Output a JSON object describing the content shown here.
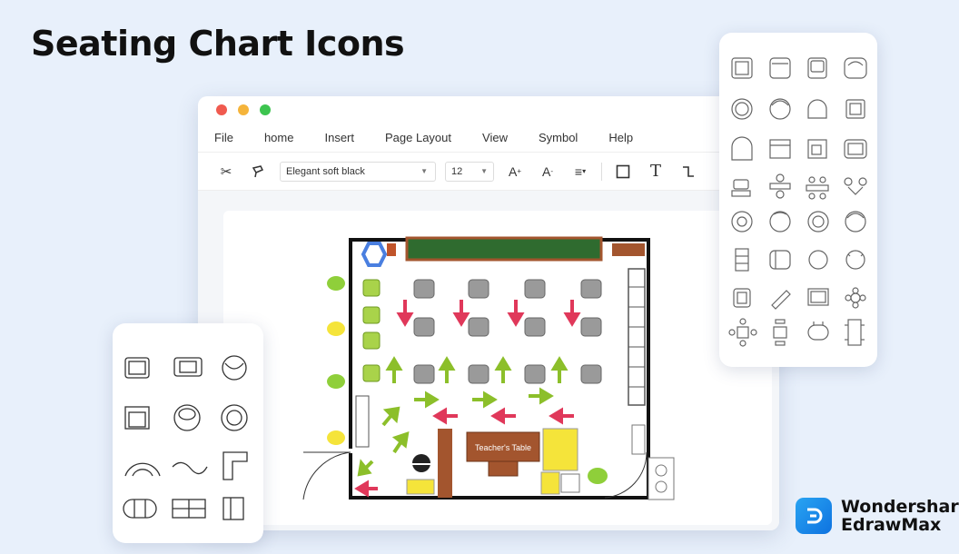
{
  "hero": {
    "title": "Seating Chart Icons"
  },
  "window": {
    "menu": [
      "File",
      "home",
      "Insert",
      "Page Layout",
      "View",
      "Symbol",
      "Help"
    ],
    "toolbar": {
      "font_name": "Elegant soft black",
      "font_size": "12",
      "icons": [
        "cut-icon",
        "format-painter-icon",
        "font-increase-icon",
        "font-decrease-icon",
        "align-icon",
        "rectangle-icon",
        "text-icon",
        "connector-icon"
      ]
    }
  },
  "floorplan": {
    "teacher_table_label": "Teacher's Table"
  },
  "brand": {
    "line1": "Wondershare",
    "line2": "EdrawMax"
  },
  "colors": {
    "background": "#e8f0fb",
    "accent": "#0e72e0",
    "desk_gray": "#9a9a9a",
    "arrow_red": "#e0385a",
    "arrow_green": "#8cbf2a",
    "board_green": "#2f6b2f",
    "wood": "#a3552e",
    "yellow": "#f5e43a"
  }
}
